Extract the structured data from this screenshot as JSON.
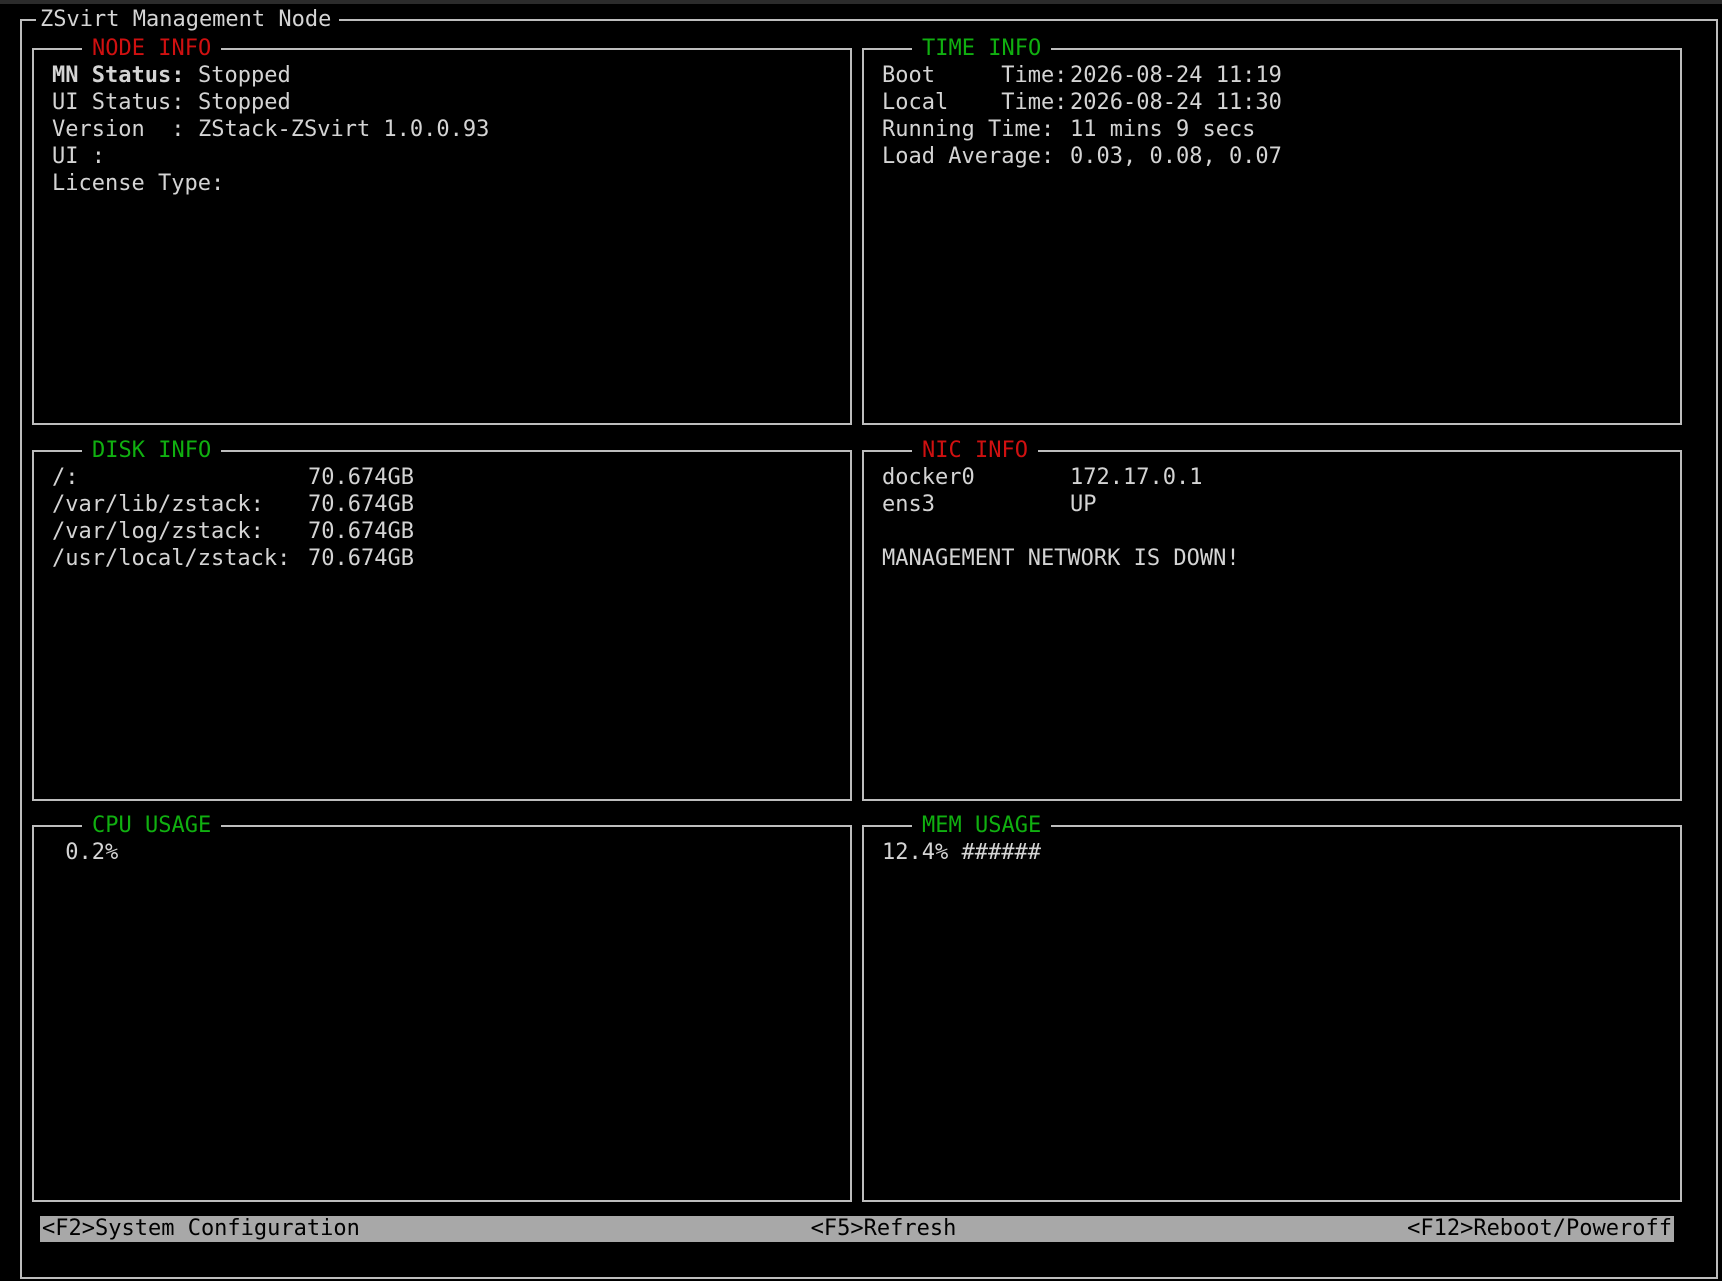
{
  "window": {
    "title": "ZSvirt Management Node"
  },
  "node_info": {
    "title": "NODE INFO",
    "rows": [
      {
        "label": "MN Status:",
        "value": "Stopped"
      },
      {
        "label": "UI Status:",
        "value": "Stopped"
      },
      {
        "label": "Version  :",
        "value": "ZStack-ZSvirt 1.0.0.93"
      },
      {
        "label": "UI :",
        "value": ""
      },
      {
        "label": "License Type:",
        "value": ""
      }
    ]
  },
  "time_info": {
    "title": "TIME INFO",
    "rows": [
      {
        "label": "Boot     Time:",
        "value": "2026-08-24 11:19"
      },
      {
        "label": "Local    Time:",
        "value": "2026-08-24 11:30"
      },
      {
        "label": "Running Time:",
        "value": "11 mins 9 secs"
      },
      {
        "label": "Load Average:",
        "value": "0.03, 0.08, 0.07"
      }
    ]
  },
  "disk_info": {
    "title": "DISK INFO",
    "rows": [
      {
        "label": "/:",
        "value": "70.674GB"
      },
      {
        "label": "/var/lib/zstack:",
        "value": "70.674GB"
      },
      {
        "label": "/var/log/zstack:",
        "value": "70.674GB"
      },
      {
        "label": "/usr/local/zstack:",
        "value": "70.674GB"
      }
    ]
  },
  "nic_info": {
    "title": "NIC INFO",
    "rows": [
      {
        "label": "docker0",
        "value": "172.17.0.1"
      },
      {
        "label": "ens3",
        "value": "UP"
      }
    ],
    "warning": "MANAGEMENT NETWORK IS DOWN!"
  },
  "cpu_usage": {
    "title": "CPU USAGE",
    "value": " 0.2%"
  },
  "mem_usage": {
    "title": "MEM USAGE",
    "value": "12.4% ######"
  },
  "statusbar": {
    "f2": "<F2>System Configuration",
    "f5": "<F5>Refresh",
    "f12": "<F12>Reboot/Poweroff"
  },
  "colors": {
    "red_title": "#d01010",
    "green_title": "#10b010",
    "text": "#d4d4d4",
    "statusbar_bg": "#a8a8a8"
  }
}
